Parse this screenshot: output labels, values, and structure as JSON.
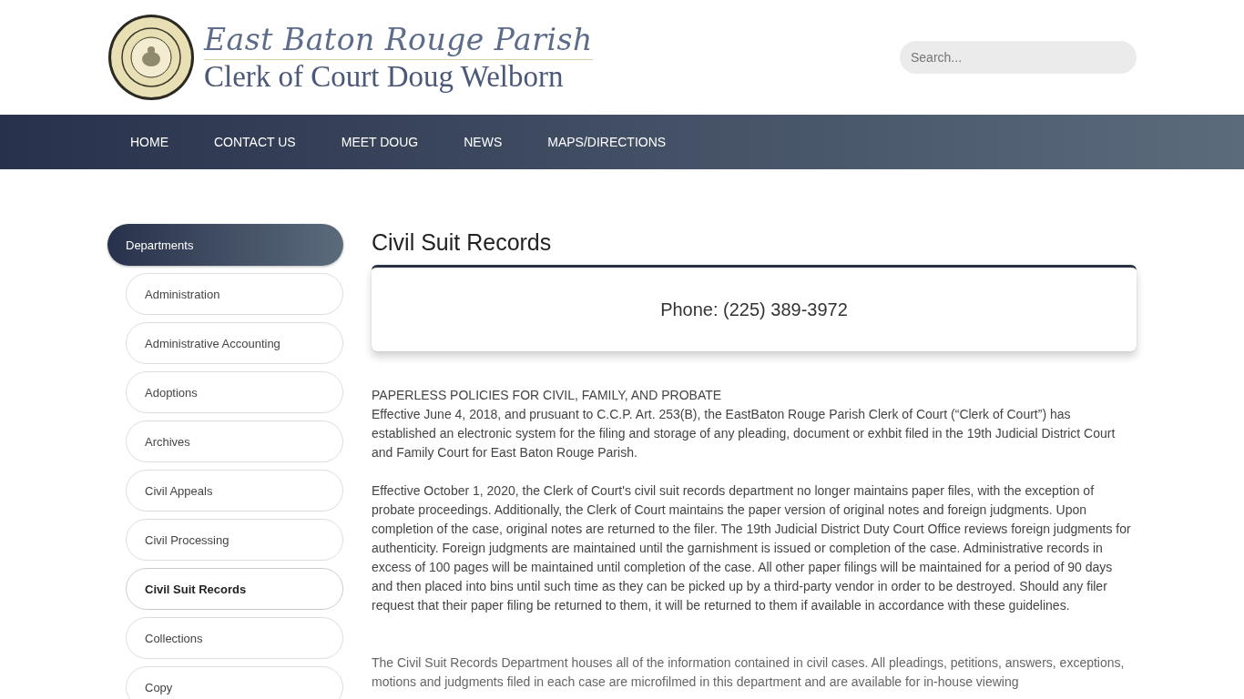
{
  "header": {
    "logo_title": "East Baton Rouge Parish",
    "logo_subtitle": "Clerk of Court Doug Welborn",
    "search": {
      "placeholder": "Search..."
    }
  },
  "nav": [
    {
      "label": "HOME"
    },
    {
      "label": "CONTACT US"
    },
    {
      "label": "MEET DOUG"
    },
    {
      "label": "NEWS"
    },
    {
      "label": "MAPS/DIRECTIONS"
    }
  ],
  "sidebar": {
    "heading": "Departments",
    "items": [
      {
        "label": "Administration",
        "selected": false
      },
      {
        "label": "Administrative Accounting",
        "selected": false
      },
      {
        "label": "Adoptions",
        "selected": false
      },
      {
        "label": "Archives",
        "selected": false
      },
      {
        "label": "Civil Appeals",
        "selected": false
      },
      {
        "label": "Civil Processing",
        "selected": false
      },
      {
        "label": "Civil Suit Records",
        "selected": true
      },
      {
        "label": "Collections",
        "selected": false
      },
      {
        "label": "Copy",
        "selected": false
      }
    ]
  },
  "content": {
    "title": "Civil Suit Records",
    "phone": "Phone: (225) 389-3972",
    "paragraphs": [
      {
        "heading": "PAPERLESS POLICIES FOR CIVIL, FAMILY, AND PROBATE",
        "text": "Effective June 4, 2018, and prusuant to C.C.P. Art. 253(B), the EastBaton Rouge Parish Clerk of Court (“Clerk of Court”) has established an electronic system for the filing and storage of any pleading, document or exhbit filed in the 19th Judicial District Court and Family Court for East Baton Rouge Parish."
      },
      {
        "text": "Effective October 1, 2020, the Clerk of Court's civil suit records department no longer maintains paper files, with the exception of probate proceedings. Additionally, the Clerk of Court maintains the paper version of original notes and foreign judgments. Upon completion of the case, original notes are returned to the filer. The 19th Judicial District Duty Court Office reviews foreign judgments for authenticity. Foreign judgments are maintained until the garnishment is issued or completion of the case. Administrative records in excess of 100 pages will be maintained until completion of the case. All other paper filings will be maintained for a period of 90 days and then placed into bins until such time as they can be picked up by a third-party vendor in order to be destroyed. Should any filer request that their paper filing be returned to them, it will be returned to them if available in accordance with these guidelines."
      },
      {
        "text": "The Civil Suit Records Department houses all of the information contained in civil cases. All pleadings, petitions, answers, exceptions, motions and judgments filed in each case are microfilmed in this department and are available for in-house viewing"
      }
    ]
  }
}
